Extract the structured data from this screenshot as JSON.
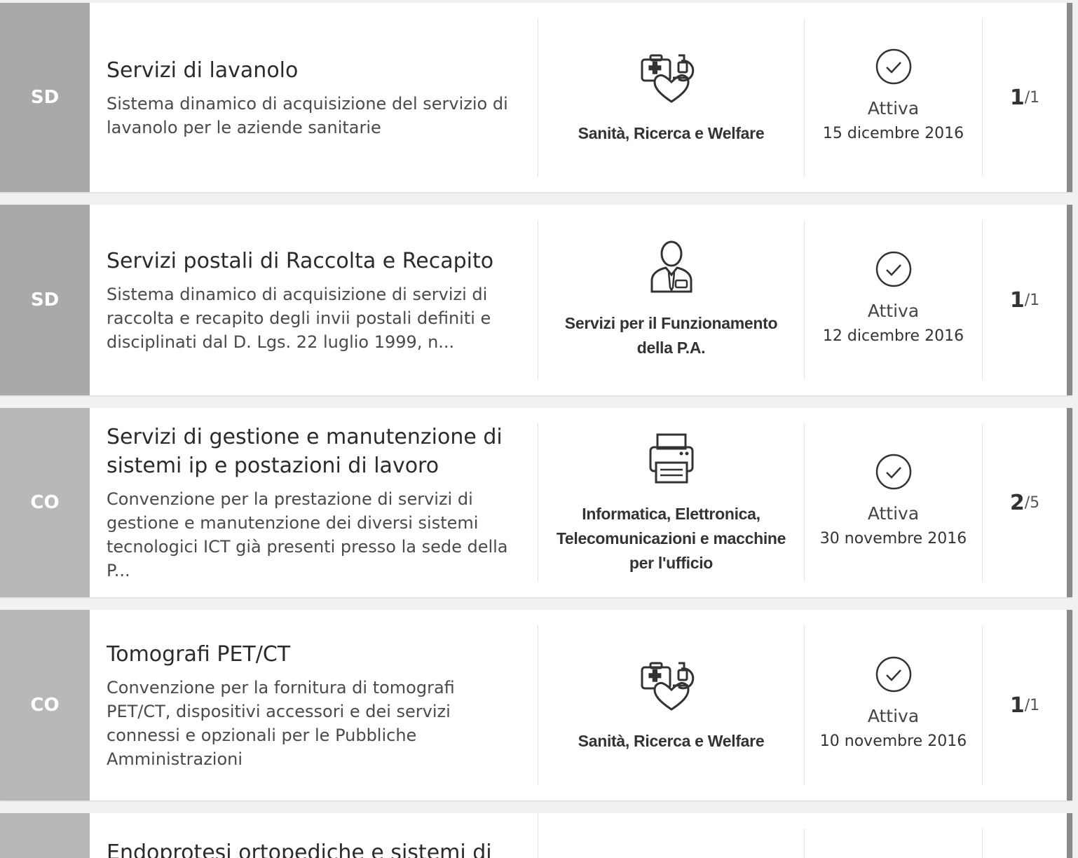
{
  "items": [
    {
      "badge": "SD",
      "title": "Servizi di lavanolo",
      "description": "Sistema dinamico di acquisizione del servizio di lavanolo per le aziende sanitarie",
      "category": "Sanità, Ricerca e Welfare",
      "category_icon": "health-icon",
      "status": "Attiva",
      "date": "15 dicembre 2016",
      "lot_current": "1",
      "lot_separator": "/",
      "lot_total": "1"
    },
    {
      "badge": "SD",
      "title": "Servizi postali di Raccolta e Recapito",
      "description": "Sistema dinamico di acquisizione di servizi di raccolta e recapito degli invii postali definiti e disciplinati dal D. Lgs. 22 luglio 1999, n...",
      "category": "Servizi per il Funzionamento della P.A.",
      "category_icon": "official-person-icon",
      "status": "Attiva",
      "date": "12 dicembre 2016",
      "lot_current": "1",
      "lot_separator": "/",
      "lot_total": "1"
    },
    {
      "badge": "CO",
      "title": "Servizi di gestione e manutenzione di sistemi ip e postazioni di lavoro",
      "description": "Convenzione per la prestazione di servizi di gestione e manutenzione dei diversi sistemi tecnologici ICT già presenti presso la sede della P...",
      "category": "Informatica, Elettronica, Telecomunicazioni e macchine per l'ufficio",
      "category_icon": "printer-icon",
      "status": "Attiva",
      "date": "30 novembre 2016",
      "lot_current": "2",
      "lot_separator": "/",
      "lot_total": "5"
    },
    {
      "badge": "CO",
      "title": "Tomografi PET/CT",
      "description": "Convenzione per la fornitura di tomografi PET/CT, dispositivi accessori e dei servizi connessi e opzionali per le Pubbliche Amministrazioni",
      "category": "Sanità, Ricerca e Welfare",
      "category_icon": "health-icon",
      "status": "Attiva",
      "date": "10 novembre 2016",
      "lot_current": "1",
      "lot_separator": "/",
      "lot_total": "1"
    },
    {
      "badge": "",
      "title": "Endoprotesi ortopediche e sistemi di",
      "description": "",
      "category": "",
      "category_icon": "",
      "status": "",
      "date": "",
      "lot_current": "",
      "lot_separator": "",
      "lot_total": ""
    }
  ]
}
